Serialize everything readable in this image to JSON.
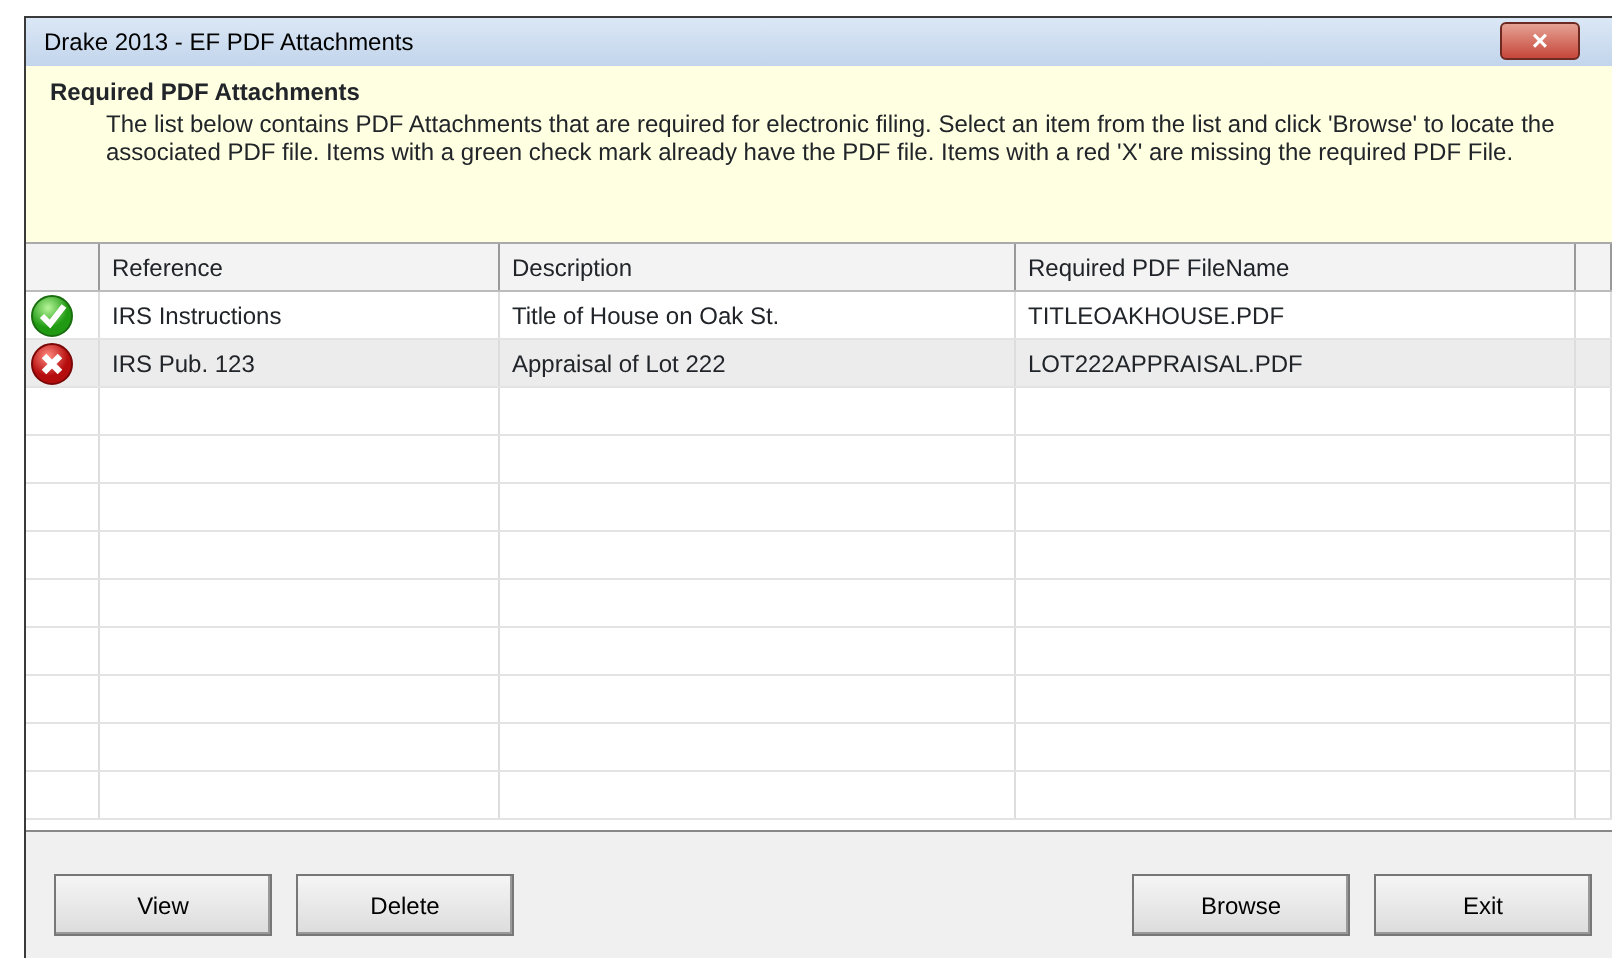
{
  "window": {
    "title": "Drake 2013 - EF PDF Attachments",
    "close": "×"
  },
  "header": {
    "title": "Required PDF Attachments",
    "text": "The list below contains PDF Attachments that are required for electronic filing. Select an item from the list and click 'Browse' to locate the associated PDF file. Items with a green check mark already have the PDF file. Items with a red 'X' are missing the required PDF File."
  },
  "table": {
    "columns": [
      "Reference",
      "Description",
      "Required PDF FileName"
    ],
    "rows": [
      {
        "kind": "ok",
        "selected": false,
        "cells": [
          "IRS Instructions",
          "Title of House on Oak St.",
          "TITLEOAKHOUSE.PDF"
        ]
      },
      {
        "kind": "missing",
        "selected": true,
        "cells": [
          "IRS Pub. 123",
          "Appraisal of Lot 222",
          "LOT222APPRAISAL.PDF"
        ]
      }
    ]
  },
  "buttons_left": [
    "View",
    "Delete"
  ],
  "buttons_right": [
    "Browse",
    "Exit"
  ]
}
